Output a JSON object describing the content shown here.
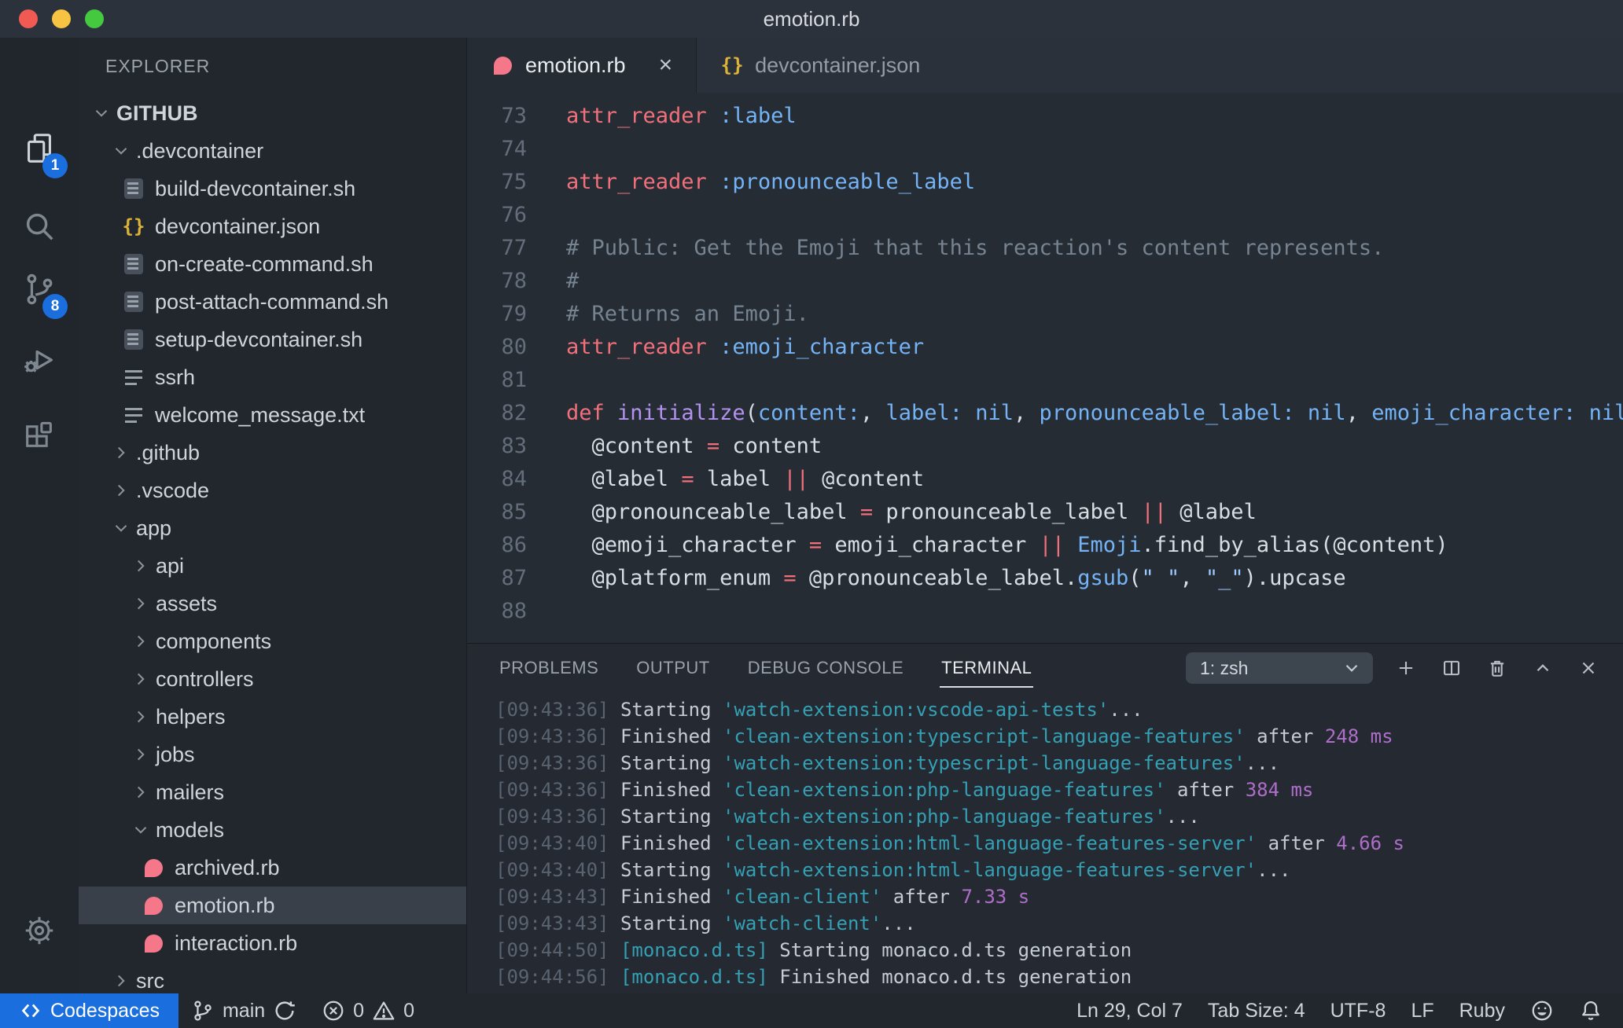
{
  "titlebar": {
    "title": "emotion.rb"
  },
  "activity_bar": {
    "explorer_badge": "1",
    "scm_badge": "8"
  },
  "sidebar": {
    "header": "EXPLORER",
    "items": [
      {
        "label": "GITHUB",
        "type": "folder",
        "state": "expanded",
        "indent": 0,
        "root": true
      },
      {
        "label": ".devcontainer",
        "type": "folder",
        "state": "expanded",
        "indent": 1
      },
      {
        "label": "build-devcontainer.sh",
        "type": "file",
        "icon": "shell",
        "indent": 2
      },
      {
        "label": "devcontainer.json",
        "type": "file",
        "icon": "json",
        "indent": 2
      },
      {
        "label": "on-create-command.sh",
        "type": "file",
        "icon": "shell",
        "indent": 2
      },
      {
        "label": "post-attach-command.sh",
        "type": "file",
        "icon": "shell",
        "indent": 2
      },
      {
        "label": "setup-devcontainer.sh",
        "type": "file",
        "icon": "shell",
        "indent": 2
      },
      {
        "label": "ssrh",
        "type": "file",
        "icon": "list",
        "indent": 2
      },
      {
        "label": "welcome_message.txt",
        "type": "file",
        "icon": "list",
        "indent": 2
      },
      {
        "label": ".github",
        "type": "folder",
        "state": "collapsed",
        "indent": 1
      },
      {
        "label": ".vscode",
        "type": "folder",
        "state": "collapsed",
        "indent": 1
      },
      {
        "label": "app",
        "type": "folder",
        "state": "expanded",
        "indent": 1
      },
      {
        "label": "api",
        "type": "folder",
        "state": "collapsed",
        "indent": 2
      },
      {
        "label": "assets",
        "type": "folder",
        "state": "collapsed",
        "indent": 2
      },
      {
        "label": "components",
        "type": "folder",
        "state": "collapsed",
        "indent": 2
      },
      {
        "label": "controllers",
        "type": "folder",
        "state": "collapsed",
        "indent": 2
      },
      {
        "label": "helpers",
        "type": "folder",
        "state": "collapsed",
        "indent": 2
      },
      {
        "label": "jobs",
        "type": "folder",
        "state": "collapsed",
        "indent": 2
      },
      {
        "label": "mailers",
        "type": "folder",
        "state": "collapsed",
        "indent": 2
      },
      {
        "label": "models",
        "type": "folder",
        "state": "expanded",
        "indent": 2
      },
      {
        "label": "archived.rb",
        "type": "file",
        "icon": "ruby",
        "indent": 3
      },
      {
        "label": "emotion.rb",
        "type": "file",
        "icon": "ruby",
        "indent": 3,
        "selected": true
      },
      {
        "label": "interaction.rb",
        "type": "file",
        "icon": "ruby",
        "indent": 3
      },
      {
        "label": "src",
        "type": "folder",
        "state": "collapsed",
        "indent": 1
      }
    ]
  },
  "tabs": {
    "active": {
      "label": "emotion.rb",
      "close": "×"
    },
    "inactive": {
      "label": "devcontainer.json"
    }
  },
  "editor": {
    "lines": [
      {
        "num": 73,
        "tokens": [
          [
            "keyword",
            "attr_reader"
          ],
          [
            "text",
            " "
          ],
          [
            "symbol",
            ":label"
          ]
        ]
      },
      {
        "num": 74,
        "tokens": []
      },
      {
        "num": 75,
        "tokens": [
          [
            "keyword",
            "attr_reader"
          ],
          [
            "text",
            " "
          ],
          [
            "symbol",
            ":pronounceable_label"
          ]
        ]
      },
      {
        "num": 76,
        "tokens": []
      },
      {
        "num": 77,
        "tokens": [
          [
            "comment",
            "# Public: Get the Emoji that this reaction's content represents."
          ]
        ]
      },
      {
        "num": 78,
        "tokens": [
          [
            "comment",
            "#"
          ]
        ]
      },
      {
        "num": 79,
        "tokens": [
          [
            "comment",
            "# Returns an Emoji."
          ]
        ]
      },
      {
        "num": 80,
        "tokens": [
          [
            "keyword",
            "attr_reader"
          ],
          [
            "text",
            " "
          ],
          [
            "symbol",
            ":emoji_character"
          ]
        ]
      },
      {
        "num": 81,
        "tokens": []
      },
      {
        "num": 82,
        "tokens": [
          [
            "keyword",
            "def"
          ],
          [
            "text",
            " "
          ],
          [
            "function",
            "initialize"
          ],
          [
            "text",
            "("
          ],
          [
            "symbol",
            "content:"
          ],
          [
            "text",
            ", "
          ],
          [
            "symbol",
            "label:"
          ],
          [
            "text",
            " "
          ],
          [
            "symbol",
            "nil"
          ],
          [
            "text",
            ", "
          ],
          [
            "symbol",
            "pronounceable_label:"
          ],
          [
            "text",
            " "
          ],
          [
            "symbol",
            "nil"
          ],
          [
            "text",
            ", "
          ],
          [
            "symbol",
            "emoji_character:"
          ],
          [
            "text",
            " "
          ],
          [
            "symbol",
            "nil"
          ],
          [
            "text",
            ")"
          ]
        ]
      },
      {
        "num": 83,
        "tokens": [
          [
            "text",
            "  @content "
          ],
          [
            "keyword",
            "="
          ],
          [
            "text",
            " content"
          ]
        ]
      },
      {
        "num": 84,
        "tokens": [
          [
            "text",
            "  @label "
          ],
          [
            "keyword",
            "="
          ],
          [
            "text",
            " label "
          ],
          [
            "keyword",
            "||"
          ],
          [
            "text",
            " @content"
          ]
        ]
      },
      {
        "num": 85,
        "tokens": [
          [
            "text",
            "  @pronounceable_label "
          ],
          [
            "keyword",
            "="
          ],
          [
            "text",
            " pronounceable_label "
          ],
          [
            "keyword",
            "||"
          ],
          [
            "text",
            " @label"
          ]
        ]
      },
      {
        "num": 86,
        "tokens": [
          [
            "text",
            "  @emoji_character "
          ],
          [
            "keyword",
            "="
          ],
          [
            "text",
            " emoji_character "
          ],
          [
            "keyword",
            "||"
          ],
          [
            "text",
            " "
          ],
          [
            "symbol",
            "Emoji"
          ],
          [
            "text",
            ".find_by_alias(@content)"
          ]
        ]
      },
      {
        "num": 87,
        "tokens": [
          [
            "text",
            "  @platform_enum "
          ],
          [
            "keyword",
            "="
          ],
          [
            "text",
            " @pronounceable_label."
          ],
          [
            "symbol",
            "gsub"
          ],
          [
            "text",
            "("
          ],
          [
            "string",
            "\" \""
          ],
          [
            "text",
            ", "
          ],
          [
            "string",
            "\"_\""
          ],
          [
            "text",
            ").upcase"
          ]
        ]
      },
      {
        "num": 88,
        "tokens": []
      }
    ]
  },
  "panel": {
    "tabs": [
      "PROBLEMS",
      "OUTPUT",
      "DEBUG CONSOLE",
      "TERMINAL"
    ],
    "active_tab": "TERMINAL",
    "shell_selector": "1: zsh",
    "terminal_lines": [
      [
        [
          "time",
          "[09:43:36]"
        ],
        [
          "text",
          " Starting "
        ],
        [
          "task",
          "'watch-extension:vscode-api-tests'"
        ],
        [
          "text",
          "..."
        ]
      ],
      [
        [
          "time",
          "[09:43:36]"
        ],
        [
          "text",
          " Finished "
        ],
        [
          "task",
          "'clean-extension:typescript-language-features'"
        ],
        [
          "text",
          " after "
        ],
        [
          "number",
          "248 ms"
        ]
      ],
      [
        [
          "time",
          "[09:43:36]"
        ],
        [
          "text",
          " Starting "
        ],
        [
          "task",
          "'watch-extension:typescript-language-features'"
        ],
        [
          "text",
          "..."
        ]
      ],
      [
        [
          "time",
          "[09:43:36]"
        ],
        [
          "text",
          " Finished "
        ],
        [
          "task",
          "'clean-extension:php-language-features'"
        ],
        [
          "text",
          " after "
        ],
        [
          "number",
          "384 ms"
        ]
      ],
      [
        [
          "time",
          "[09:43:36]"
        ],
        [
          "text",
          " Starting "
        ],
        [
          "task",
          "'watch-extension:php-language-features'"
        ],
        [
          "text",
          "..."
        ]
      ],
      [
        [
          "time",
          "[09:43:40]"
        ],
        [
          "text",
          " Finished "
        ],
        [
          "task",
          "'clean-extension:html-language-features-server'"
        ],
        [
          "text",
          " after "
        ],
        [
          "number",
          "4.66 s"
        ]
      ],
      [
        [
          "time",
          "[09:43:40]"
        ],
        [
          "text",
          " Starting "
        ],
        [
          "task",
          "'watch-extension:html-language-features-server'"
        ],
        [
          "text",
          "..."
        ]
      ],
      [
        [
          "time",
          "[09:43:43]"
        ],
        [
          "text",
          " Finished "
        ],
        [
          "task",
          "'clean-client'"
        ],
        [
          "text",
          " after "
        ],
        [
          "number",
          "7.33 s"
        ]
      ],
      [
        [
          "time",
          "[09:43:43]"
        ],
        [
          "text",
          " Starting "
        ],
        [
          "task",
          "'watch-client'"
        ],
        [
          "text",
          "..."
        ]
      ],
      [
        [
          "time",
          "[09:44:50]"
        ],
        [
          "task",
          " [monaco.d.ts]"
        ],
        [
          "text",
          " Starting monaco.d.ts generation"
        ]
      ],
      [
        [
          "time",
          "[09:44:56]"
        ],
        [
          "task",
          " [monaco.d.ts]"
        ],
        [
          "text",
          " Finished monaco.d.ts generation"
        ]
      ]
    ]
  },
  "statusbar": {
    "codespaces": "Codespaces",
    "branch": "main",
    "errors": "0",
    "warnings": "0",
    "right": [
      "Ln 29, Col 7",
      "Tab Size: 4",
      "UTF-8",
      "LF",
      "Ruby"
    ]
  }
}
